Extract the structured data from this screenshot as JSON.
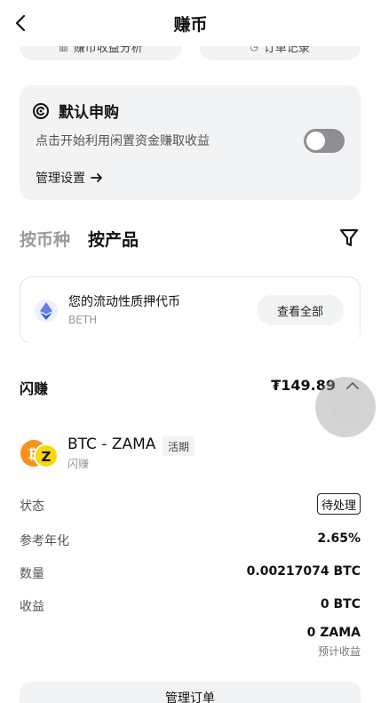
{
  "header": {
    "title": "赚币"
  },
  "top_pills": {
    "left_label": "赚币收益分析",
    "right_label": "订单记录"
  },
  "auto_subscribe": {
    "title": "默认申购",
    "description": "点击开始利用闲置资金赚取收益",
    "toggle_on": false,
    "manage_label": "管理设置"
  },
  "tabs": [
    {
      "label": "按币种",
      "active": false
    },
    {
      "label": "按产品",
      "active": true
    }
  ],
  "product_card": {
    "name": "您的流动性质押代币",
    "symbol": "BETH",
    "view_all_label": "查看全部"
  },
  "flash": {
    "label": "闪赚",
    "total": "₮149.89"
  },
  "coin": {
    "name": "BTC - ZAMA",
    "badge": "活期",
    "subtitle": "闪赚"
  },
  "details": {
    "status_label": "状态",
    "status_value": "待处理",
    "apr_label": "参考年化",
    "apr_value": "2.65%",
    "amount_label": "数量",
    "amount_value": "0.00217074 BTC",
    "earnings_label": "收益",
    "earnings_value": "0 BTC",
    "earnings_zama": "0 ZAMA",
    "est_label": "预计收益"
  },
  "footer": {
    "manage_order_label": "管理订单"
  },
  "colors": {
    "accent_yellow": "#f5b50a",
    "eth_blue": "#627eea",
    "toggle_off": "#8e8e93"
  }
}
